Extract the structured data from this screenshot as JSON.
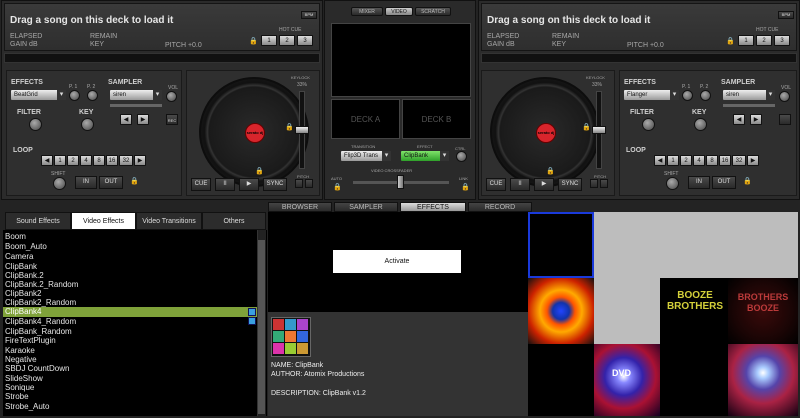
{
  "deck_left": {
    "title": "Drag a song on this deck to load it",
    "elapsed": "ELAPSED",
    "gain": "GAIN dB",
    "remain": "REMAIN",
    "key": "KEY",
    "pitch": "PITCH +0.0",
    "bpm_btn": "BPM",
    "hotcue_label": "HOT CUE",
    "hotcues": [
      "1",
      "2",
      "3"
    ],
    "effects_label": "EFFECTS",
    "effect_value": "BeatGrid",
    "p1": "P. 1",
    "p2": "P. 2",
    "sampler_label": "SAMPLER",
    "sampler_value": "siren",
    "vol": "VOL",
    "filter": "FILTER",
    "key_label": "KEY",
    "loop_label": "LOOP",
    "loop_values": [
      "1",
      "2",
      "4",
      "8",
      "16",
      "32"
    ],
    "shift": "SHIFT",
    "in": "IN",
    "out": "OUT",
    "rec": "REC",
    "keylock": "KEYLOCK",
    "keylock_pct": "33%",
    "pitch_label": "PITCH",
    "transport": [
      "CUE",
      "II",
      "▶",
      "SYNC"
    ],
    "platter_brand": "serato dj"
  },
  "deck_right": {
    "title": "Drag a song on this deck to load it",
    "elapsed": "ELAPSED",
    "gain": "GAIN dB",
    "remain": "REMAIN",
    "key": "KEY",
    "pitch": "PITCH +0.0",
    "bpm_btn": "BPM",
    "hotcue_label": "HOT CUE",
    "hotcues": [
      "1",
      "2",
      "3"
    ],
    "effects_label": "EFFECTS",
    "effect_value": "Flanger",
    "p1": "P. 1",
    "p2": "P. 2",
    "sampler_label": "SAMPLER",
    "sampler_value": "siren",
    "vol": "VOL",
    "filter": "FILTER",
    "key_label": "KEY",
    "loop_label": "LOOP",
    "loop_values": [
      "1",
      "2",
      "4",
      "8",
      "16",
      "32"
    ],
    "shift": "SHIFT",
    "in": "IN",
    "out": "OUT",
    "keylock": "KEYLOCK",
    "keylock_pct": "33%",
    "pitch_label": "PITCH",
    "transport": [
      "CUE",
      "II",
      "▶",
      "SYNC"
    ],
    "platter_brand": "serato dj"
  },
  "mixer": {
    "tabs": [
      "MIXER",
      "VIDEO",
      "SCRATCH"
    ],
    "active_tab": "VIDEO",
    "deck_a": "DECK A",
    "deck_b": "DECK B",
    "transition_label": "TRANSITION",
    "transition_value": "Flip3D Trans",
    "effect_label": "EFFECT",
    "effect_value": "ClipBank",
    "ctrl": "CTRL",
    "auto": "AUTO",
    "link": "LINK",
    "crossfader_label": "VIDEO CROSSFADER"
  },
  "browser_tabs": {
    "items": [
      "BROWSER",
      "SAMPLER",
      "EFFECTS",
      "RECORD"
    ],
    "active": "EFFECTS"
  },
  "effect_tabs": {
    "items": [
      "Sound Effects",
      "Video Effects",
      "Video Transitions",
      "Others"
    ],
    "active": "Video Effects"
  },
  "effects_list": {
    "items": [
      "Boom",
      "Boom_Auto",
      "Camera",
      "ClipBank",
      "ClipBank.2",
      "ClipBank.2_Random",
      "ClipBank2",
      "ClipBank2_Random",
      "ClipBank4",
      "ClipBank4_Random",
      "ClipBank_Random",
      "FireTextPlugin",
      "Karaoke",
      "Negative",
      "SBDJ CountDown",
      "SlideShow",
      "Sonique",
      "Strobe",
      "Strobe_Auto"
    ],
    "selected": "ClipBank4"
  },
  "effect_detail": {
    "activate": "Activate",
    "name": "NAME: ClipBank",
    "author": "AUTHOR: Atomix Productions",
    "description": "DESCRIPTION: ClipBank v1.2"
  },
  "clips": {
    "booze_text": "BOOZE BROTHERS",
    "brothers_text": "BROTHERS BOOZE",
    "dvd_text": "DVD"
  },
  "colors": {
    "accent_green": "#7fa23a",
    "selected_border": "#1a3adb",
    "lock": "#d79a1c",
    "platter_red": "#d8252c"
  }
}
